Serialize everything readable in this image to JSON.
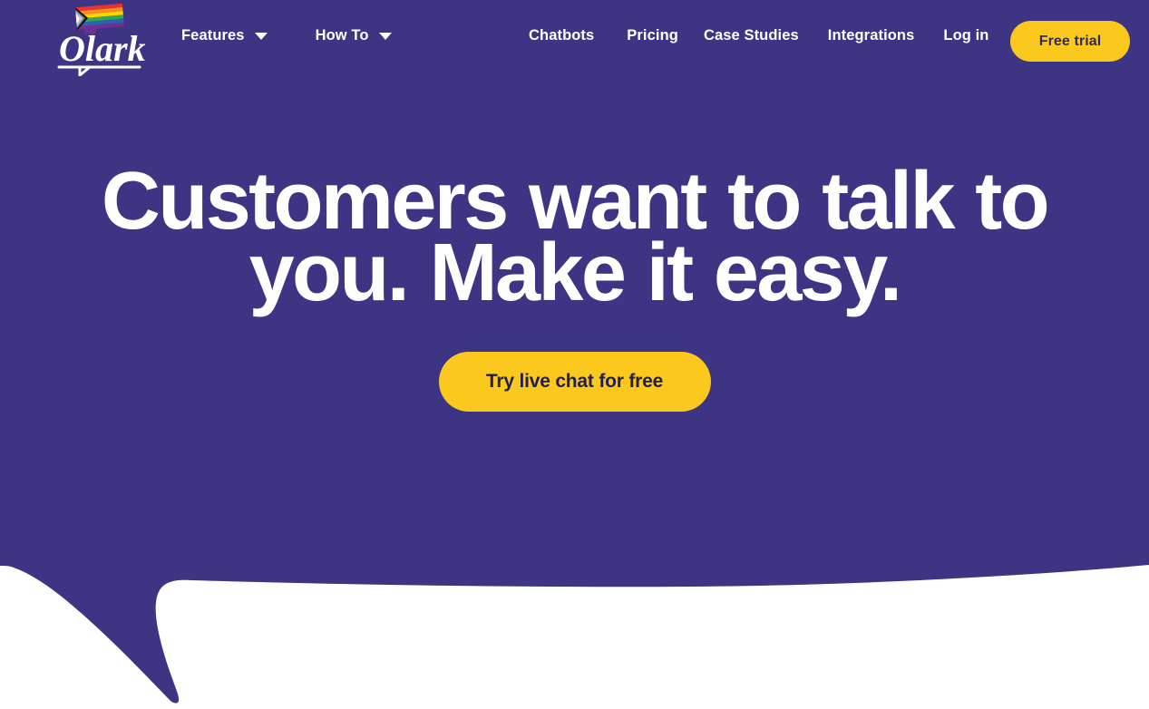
{
  "theme": {
    "brand_purple": "#3D3484",
    "accent_yellow": "#FBC91D",
    "cta_text_color": "#23204E",
    "page_background": "#FFFFFF",
    "nav_text_color": "#FFFFFF"
  },
  "header": {
    "logo": {
      "wordmark": "Olark",
      "icon_name": "olark-logo-with-progress-pride-flag",
      "flag_stripes": [
        "#E6352B",
        "#F68E1F",
        "#FFD400",
        "#2DA94F",
        "#2B63B0",
        "#6F3094"
      ],
      "chevron_stripes": [
        "#FFFFFF",
        "#FFAFC8",
        "#5BCEFA",
        "#7A4B22",
        "#000000"
      ]
    },
    "nav_left": [
      {
        "label": "Features",
        "has_dropdown": true,
        "icon": "chevron-down-icon"
      },
      {
        "label": "How To",
        "has_dropdown": true,
        "icon": "chevron-down-icon"
      }
    ],
    "nav_right": [
      {
        "label": "Chatbots"
      },
      {
        "label": "Pricing"
      },
      {
        "label": "Case Studies"
      },
      {
        "label": "Integrations"
      },
      {
        "label": "Log in"
      }
    ],
    "free_trial_label": "Free trial"
  },
  "hero": {
    "headline_line1": "Customers want to talk to",
    "headline_line2": "you. Make it easy.",
    "cta_label": "Try live chat for free"
  }
}
